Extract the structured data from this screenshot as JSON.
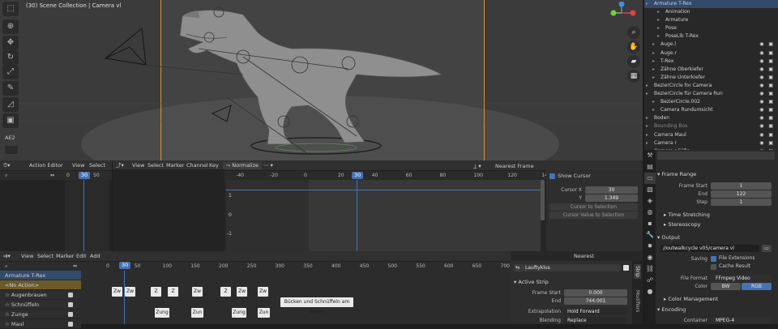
{
  "viewport": {
    "title": "(30) Scene Collection | Camera vl",
    "tools": [
      "select-icon",
      "cursor-icon",
      "move-icon",
      "rotate-icon",
      "scale-icon",
      "transform-icon",
      "annotate-icon",
      "measure-icon",
      "camera-view-icon"
    ],
    "ae_label": "AE2"
  },
  "outliner": {
    "rows": [
      {
        "label": "Armature T-Rex",
        "icons": "▾ ✛"
      },
      {
        "label": "Animation",
        "icons": ""
      },
      {
        "label": "Armature",
        "icons": ""
      },
      {
        "label": "Pose",
        "icons": ""
      },
      {
        "label": "PoseLib T-Rex",
        "icons": ""
      },
      {
        "label": "Auge.l",
        "icons": ""
      },
      {
        "label": "Auge.r",
        "icons": ""
      },
      {
        "label": "T-Rex",
        "icons": ""
      },
      {
        "label": "Zähne Oberkiefer",
        "icons": ""
      },
      {
        "label": "Zähne Unterkiefer",
        "icons": ""
      },
      {
        "label": "BezierCircle for Camera",
        "icons": ""
      },
      {
        "label": "BezierCircle für Camera Run",
        "icons": ""
      },
      {
        "label": "BezierCircle.002",
        "icons": ""
      },
      {
        "label": "Camera Rundumsicht",
        "icons": ""
      },
      {
        "label": "Boden",
        "icons": ""
      },
      {
        "label": "Bounding Box",
        "icons": ""
      },
      {
        "label": "Camera Maul",
        "icons": ""
      },
      {
        "label": "Camera r",
        "icons": ""
      },
      {
        "label": "Camera r Füße",
        "icons": ""
      }
    ]
  },
  "action_editor": {
    "mode": "Action Editor",
    "menus": [
      "View",
      "Select"
    ],
    "ruler": [
      "0",
      "30",
      "50"
    ],
    "current_frame": "30"
  },
  "graph_editor": {
    "menus": [
      "View",
      "Select",
      "Marker",
      "Channel",
      "Key"
    ],
    "normalize": "Normalize",
    "snap": "Nearest Frame",
    "ruler": [
      "-40",
      "-20",
      "0",
      "20",
      "30",
      "40",
      "60",
      "80",
      "100",
      "120",
      "140"
    ],
    "current_frame": "30",
    "yticks": [
      "1",
      "0",
      "-1"
    ],
    "npanel": {
      "show_cursor": "Show Cursor",
      "cursor_x_label": "Cursor X",
      "cursor_x": "30",
      "y_label": "Y",
      "y": "1.349",
      "btn1": "Cursor to Selection",
      "btn2": "Cursor Value to Selection"
    }
  },
  "nla": {
    "menus": [
      "View",
      "Select",
      "Marker",
      "Edit",
      "Add"
    ],
    "snap": "Nearest Frame",
    "ruler": [
      "0",
      "30",
      "50",
      "100",
      "150",
      "200",
      "250",
      "300",
      "350",
      "400",
      "450",
      "500",
      "550",
      "600",
      "650",
      "700"
    ],
    "current_frame": "30",
    "channels": [
      {
        "label": "Armature T-Rex",
        "sel": true
      },
      {
        "label": "<No Action>",
        "sel": false
      },
      {
        "label": "Augenbrauen",
        "sel": false
      },
      {
        "label": "Schnüffeln",
        "sel": false
      },
      {
        "label": "Zunge",
        "sel": false
      },
      {
        "label": "Maul",
        "sel": false
      }
    ],
    "strips_row1": [
      "Zw",
      "Zw",
      "Z",
      "Z",
      "Zw",
      "Z",
      "Zw",
      "Zw"
    ],
    "strip_long": "Bücken und Schnüffeln am Boden",
    "strips_row3": [
      "Zung",
      "Zun",
      "Zung",
      "Zun"
    ],
    "strip_panel": {
      "name": "Lauftyklus",
      "section": "Active Strip",
      "frame_start_label": "Frame Start",
      "frame_start": "0.000",
      "end_label": "End",
      "end": "744.001",
      "extrapolation_label": "Extrapolation",
      "extrapolation": "Hold Forward",
      "blending_label": "Blending",
      "blending": "Replace",
      "tab_strip": "Strip",
      "tab_modifiers": "Modifiers"
    }
  },
  "properties": {
    "frame_range": "Frame Range",
    "frame_start_label": "Frame Start",
    "frame_start": "1",
    "end_label": "End",
    "end": "122",
    "step_label": "Step",
    "step": "1",
    "time_stretching": "Time Stretching",
    "stereoscopy": "Stereoscopy",
    "output": "Output",
    "path": "//outwalkcycle v05/camera vl",
    "saving_label": "Saving",
    "file_ext": "File Extensions",
    "cache_result": "Cache Result",
    "file_format_label": "File Format",
    "file_format": "FFmpeg Video",
    "color_label": "Color",
    "bw": "BW",
    "rgb": "RGB",
    "color_mgmt": "Color Management",
    "encoding": "Encoding",
    "container_label": "Container",
    "container": "MPEG-4"
  },
  "colors": {
    "accent": "#4772b3",
    "camera_frame": "#d9962d",
    "strip": "#e9e9e9"
  }
}
